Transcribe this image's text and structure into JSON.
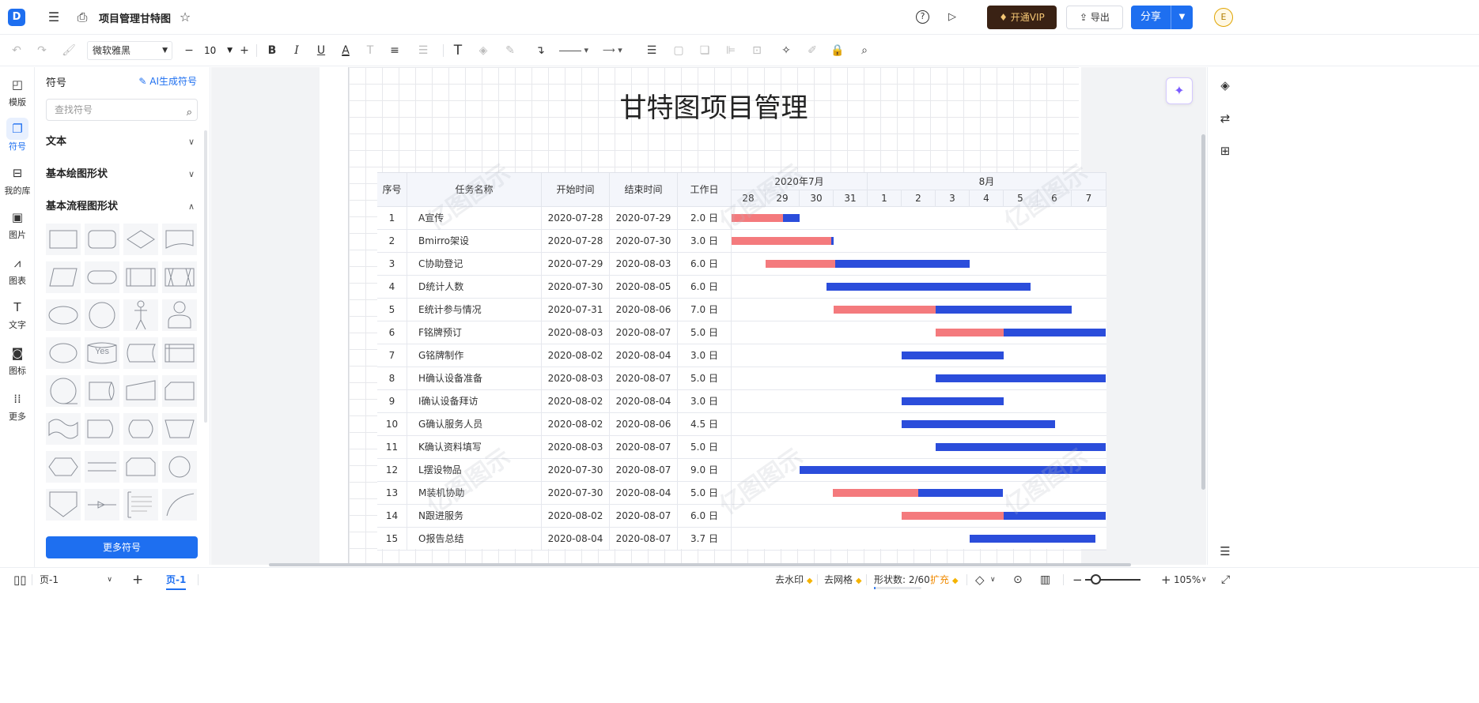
{
  "header": {
    "logo_glyph": "D",
    "doc_title": "项目管理甘特图",
    "vip_label": "开通VIP",
    "export_label": "导出",
    "share_label": "分享",
    "avatar_initial": "E"
  },
  "toolbar": {
    "font_name": "微软雅黑",
    "font_size": "10"
  },
  "rail": [
    {
      "label": "模版",
      "icon": "template-icon",
      "glyph": "◰"
    },
    {
      "label": "符号",
      "icon": "symbol-icon",
      "glyph": "❐",
      "active": true
    },
    {
      "label": "我的库",
      "icon": "library-icon",
      "glyph": "⊟"
    },
    {
      "label": "图片",
      "icon": "image-icon",
      "glyph": "▣"
    },
    {
      "label": "图表",
      "icon": "chart-icon",
      "glyph": "⩘"
    },
    {
      "label": "文字",
      "icon": "text-icon",
      "glyph": "T"
    },
    {
      "label": "图标",
      "icon": "icon-library-icon",
      "glyph": "◙"
    },
    {
      "label": "更多",
      "icon": "more-icon",
      "glyph": "⁞⁞"
    }
  ],
  "panel": {
    "title": "符号",
    "ai_link": "AI生成符号",
    "search_placeholder": "查找符号",
    "categories": [
      {
        "label": "文本",
        "expanded": false
      },
      {
        "label": "基本绘图形状",
        "expanded": false
      },
      {
        "label": "基本流程图形状",
        "expanded": true
      }
    ],
    "yes_text": "Yes",
    "more_button": "更多符号"
  },
  "gantt": {
    "title": "甘特图项目管理",
    "headers": {
      "index": "序号",
      "task": "任务名称",
      "start": "开始时间",
      "end": "结束时间",
      "duration": "工作日"
    },
    "months": [
      "2020年7月",
      "8月"
    ],
    "days": [
      "28",
      "29",
      "30",
      "31",
      "1",
      "2",
      "3",
      "4",
      "5",
      "6",
      "7"
    ],
    "colors": {
      "done": "#f47a7d",
      "remaining": "#2b4ddb"
    },
    "rows": [
      {
        "no": "1",
        "task": "A宣传",
        "start": "2020-07-28",
        "end": "2020-07-29",
        "dur": "2.0 日",
        "bar_start": 0,
        "bar_len": 2.0,
        "done": 0.75
      },
      {
        "no": "2",
        "task": "Bmirro架设",
        "start": "2020-07-28",
        "end": "2020-07-30",
        "dur": "3.0 日",
        "bar_start": 0,
        "bar_len": 3.0,
        "done": 0.98
      },
      {
        "no": "3",
        "task": "C协助登记",
        "start": "2020-07-29",
        "end": "2020-08-03",
        "dur": "6.0 日",
        "bar_start": 1,
        "bar_len": 6.0,
        "done": 0.34
      },
      {
        "no": "4",
        "task": "D统计人数",
        "start": "2020-07-30",
        "end": "2020-08-05",
        "dur": "6.0 日",
        "bar_start": 2.8,
        "bar_len": 6.0,
        "done": 0
      },
      {
        "no": "5",
        "task": "E统计参与情况",
        "start": "2020-07-31",
        "end": "2020-08-06",
        "dur": "7.0 日",
        "bar_start": 3,
        "bar_len": 7.0,
        "done": 0.43
      },
      {
        "no": "6",
        "task": "F铭牌预订",
        "start": "2020-08-03",
        "end": "2020-08-07",
        "dur": "5.0 日",
        "bar_start": 6,
        "bar_len": 5.0,
        "done": 0.4
      },
      {
        "no": "7",
        "task": "G铭牌制作",
        "start": "2020-08-02",
        "end": "2020-08-04",
        "dur": "3.0 日",
        "bar_start": 5,
        "bar_len": 3.0,
        "done": 0
      },
      {
        "no": "8",
        "task": "H确认设备准备",
        "start": "2020-08-03",
        "end": "2020-08-07",
        "dur": "5.0 日",
        "bar_start": 6,
        "bar_len": 5.0,
        "done": 0
      },
      {
        "no": "9",
        "task": "I确认设备拜访",
        "start": "2020-08-02",
        "end": "2020-08-04",
        "dur": "3.0 日",
        "bar_start": 5,
        "bar_len": 3.0,
        "done": 0
      },
      {
        "no": "10",
        "task": "G确认服务人员",
        "start": "2020-08-02",
        "end": "2020-08-06",
        "dur": "4.5 日",
        "bar_start": 5,
        "bar_len": 4.5,
        "done": 0
      },
      {
        "no": "11",
        "task": "K确认资料填写",
        "start": "2020-08-03",
        "end": "2020-08-07",
        "dur": "5.0 日",
        "bar_start": 6,
        "bar_len": 5.0,
        "done": 0
      },
      {
        "no": "12",
        "task": "L摆设物品",
        "start": "2020-07-30",
        "end": "2020-08-07",
        "dur": "9.0 日",
        "bar_start": 2,
        "bar_len": 9.0,
        "done": 0
      },
      {
        "no": "13",
        "task": "M装机协助",
        "start": "2020-07-30",
        "end": "2020-08-04",
        "dur": "5.0 日",
        "bar_start": 2.98,
        "bar_len": 5.0,
        "done": 0.5
      },
      {
        "no": "14",
        "task": "N跟进服务",
        "start": "2020-08-02",
        "end": "2020-08-07",
        "dur": "6.0 日",
        "bar_start": 5,
        "bar_len": 6.0,
        "done": 0.5
      },
      {
        "no": "15",
        "task": "O报告总结",
        "start": "2020-08-04",
        "end": "2020-08-07",
        "dur": "3.7 日",
        "bar_start": 7,
        "bar_len": 3.7,
        "done": 0
      }
    ],
    "watermark": "亿图图示"
  },
  "status": {
    "page_select": "页-1",
    "page_tab": "页-1",
    "remove_watermark": "去水印",
    "remove_grid": "去网格",
    "shape_count": "形状数: 2/60",
    "expand": "扩充",
    "zoom": "105%",
    "shape_used_fraction": 0.033
  }
}
